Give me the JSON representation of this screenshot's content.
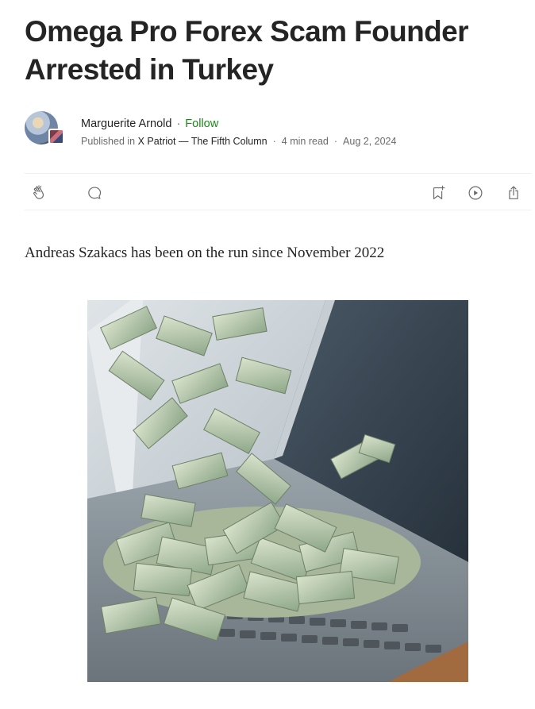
{
  "article": {
    "title": "Omega Pro Forex Scam Founder Arrested in Turkey",
    "lede": "Andreas Szakacs has been on the run since November 2022"
  },
  "byline": {
    "author_name": "Marguerite Arnold",
    "separator": "·",
    "follow_label": "Follow",
    "published_prefix": "Published in",
    "publication": "X Patriot — The Fifth Column",
    "read_time": "4 min read",
    "date": "Aug 2, 2024"
  },
  "actions": {
    "icons": [
      "clap-icon",
      "comment-icon",
      "bookmark-add-icon",
      "play-icon",
      "share-icon"
    ]
  },
  "colors": {
    "text": "#242424",
    "muted": "#6b6b6b",
    "follow": "#1a8917",
    "divider": "#f0f0f0"
  }
}
